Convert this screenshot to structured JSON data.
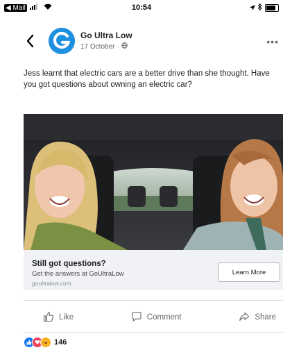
{
  "status_bar": {
    "back_app": "◀ Mail",
    "time": "10:54"
  },
  "post": {
    "page_name": "Go Ultra Low",
    "date": "17 October",
    "text": "Jess learnt that electric cars are a better drive than she thought. Have you got questions about owning an electric car?"
  },
  "cta": {
    "headline": "Still got questions?",
    "description": "Get the answers at GoUltraLow",
    "domain": "goultralow.com",
    "button_label": "Learn More"
  },
  "actions": {
    "like": "Like",
    "comment": "Comment",
    "share": "Share"
  },
  "reactions": {
    "count": "146"
  },
  "colors": {
    "brand_blue": "#1e90e0",
    "like_blue": "#1877f2",
    "love_red": "#f33e58",
    "haha_yellow": "#f7b125"
  }
}
